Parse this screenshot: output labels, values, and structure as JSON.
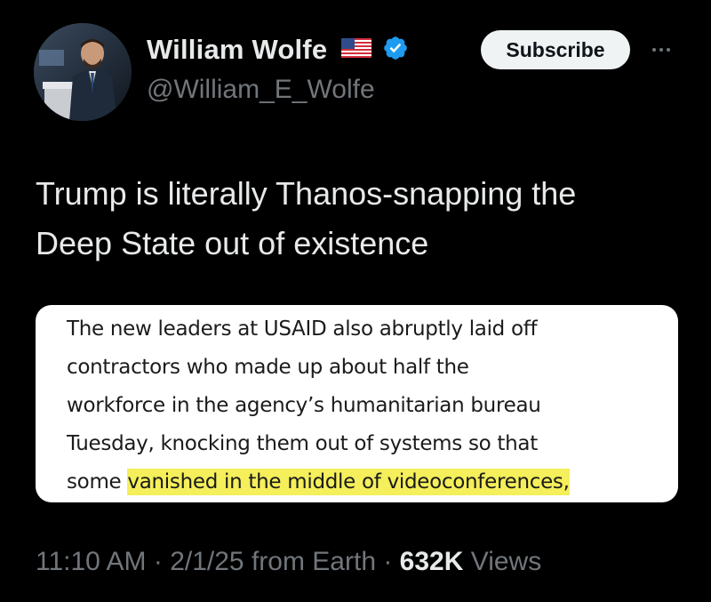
{
  "author": {
    "display_name": "William Wolfe",
    "handle": "@William_E_Wolfe",
    "flag_icon": "us-flag-icon",
    "verified_icon": "verified-badge-icon",
    "verified_color": "#1d9bf0"
  },
  "actions": {
    "subscribe_label": "Subscribe",
    "more_icon": "more-options-icon"
  },
  "tweet": {
    "text_line1": "Trump is literally Thanos-snapping the",
    "text_line2": "Deep State out of existence"
  },
  "quote_image": {
    "line1": "The new leaders at USAID also abruptly laid off",
    "line2": "contractors who made up about half the",
    "line3": "workforce in the agency’s humanitarian bureau",
    "line4": "Tuesday, knocking them out of systems so that",
    "line5_plain": "some ",
    "line5_highlight": "vanished in the middle of videoconferences,",
    "highlight_color": "#f4ef5a"
  },
  "meta": {
    "time": "11:10 AM",
    "sep1": " · ",
    "date": "2/1/25",
    "source": " from Earth",
    "sep2": " · ",
    "views_count": "632K",
    "views_label": " Views"
  }
}
